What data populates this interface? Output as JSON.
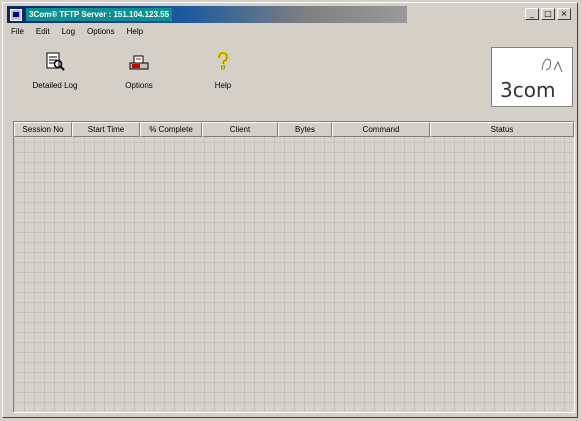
{
  "window": {
    "title": "3Com® TFTP Server : 151.104.123.55",
    "controls": {
      "minimize": "_",
      "maximize": "□",
      "close": "×"
    }
  },
  "menu": {
    "items": [
      {
        "label": "File"
      },
      {
        "label": "Edit"
      },
      {
        "label": "Log"
      },
      {
        "label": "Options"
      },
      {
        "label": "Help"
      }
    ]
  },
  "toolbar": {
    "buttons": [
      {
        "label": "Detailed Log",
        "icon": "detailed-log-icon"
      },
      {
        "label": "Options",
        "icon": "options-icon"
      },
      {
        "label": "Help",
        "icon": "help-icon"
      }
    ]
  },
  "logo": {
    "text": "3com"
  },
  "table": {
    "columns": [
      {
        "label": "Session No"
      },
      {
        "label": "Start Time"
      },
      {
        "label": "% Complete"
      },
      {
        "label": "Client"
      },
      {
        "label": "Bytes"
      },
      {
        "label": "Command"
      },
      {
        "label": "Status"
      }
    ],
    "rows": []
  },
  "colors": {
    "title_start": "#0a246a",
    "title_end": "#9a9a9a",
    "face": "#d4d0c8"
  }
}
